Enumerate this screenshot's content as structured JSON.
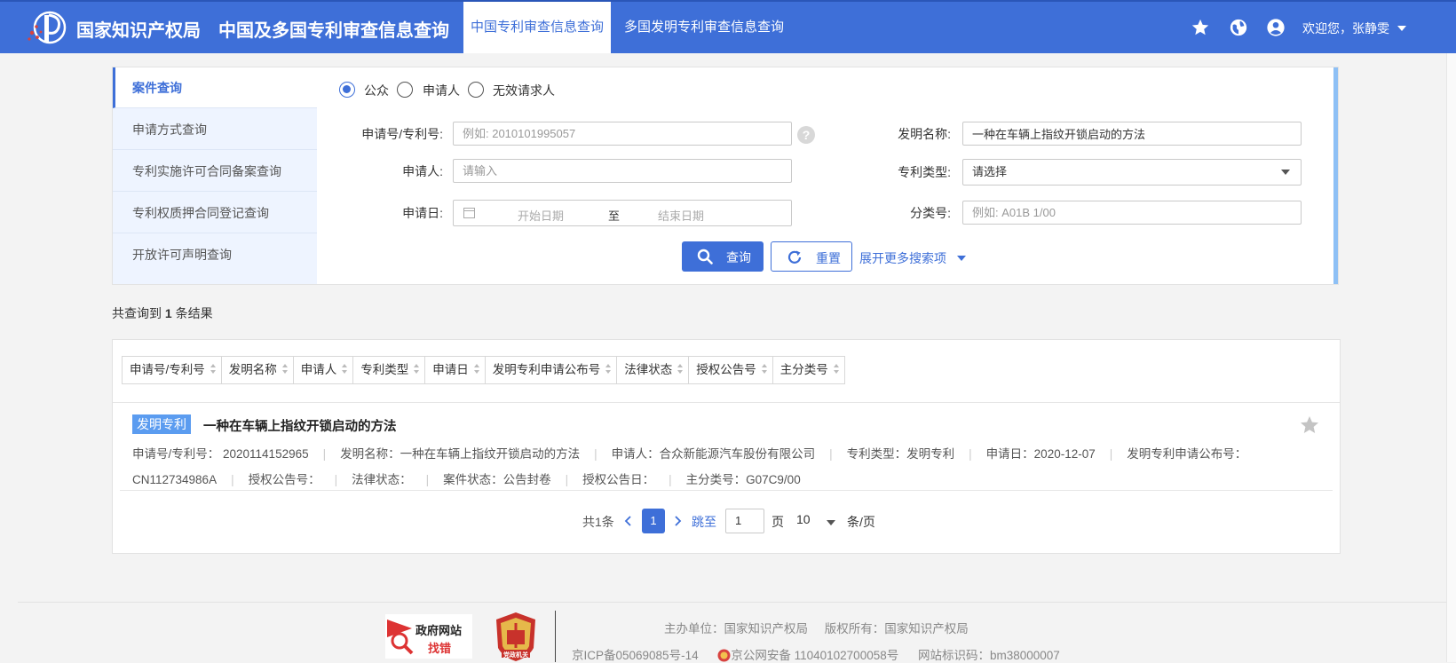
{
  "header": {
    "org_name": "国家知识产权局",
    "system_name": "中国及多国专利审查信息查询",
    "tabs": [
      {
        "label": "中国专利审查信息查询",
        "active": true
      },
      {
        "label": "多国发明专利审查信息查询",
        "active": false
      }
    ],
    "icons": [
      "star-icon",
      "globe-icon",
      "user-icon"
    ],
    "welcome": "欢迎您，张静雯",
    "colors": {
      "primary": "#3e6fd8",
      "accent_light": "#eef4ff"
    }
  },
  "side_menu": [
    {
      "label": "案件查询",
      "active": true
    },
    {
      "label": "申请方式查询",
      "active": false
    },
    {
      "label": "专利实施许可合同备案查询",
      "active": false
    },
    {
      "label": "专利权质押合同登记查询",
      "active": false
    },
    {
      "label": "开放许可声明查询",
      "active": false
    }
  ],
  "search": {
    "roles": [
      {
        "label": "公众",
        "checked": true
      },
      {
        "label": "申请人",
        "checked": false
      },
      {
        "label": "无效请求人",
        "checked": false
      }
    ],
    "app_no": {
      "label": "申请号/专利号:",
      "value": "",
      "placeholder": "例如: 2010101995057"
    },
    "invention_name": {
      "label": "发明名称:",
      "value": "一种在车辆上指纹开锁启动的方法",
      "placeholder": ""
    },
    "applicant": {
      "label": "申请人:",
      "value": "",
      "placeholder": "请输入"
    },
    "patent_type": {
      "label": "专利类型:",
      "value": "请选择"
    },
    "app_date": {
      "label": "申请日:",
      "start_placeholder": "开始日期",
      "separator": "至",
      "end_placeholder": "结束日期"
    },
    "classification": {
      "label": "分类号:",
      "value": "",
      "placeholder": "例如: A01B 1/00"
    },
    "search_label": "查询",
    "reset_label": "重置",
    "more_label": "展开更多搜索项",
    "help_glyph": "?"
  },
  "results": {
    "count_prefix": "共查询到",
    "count": "1",
    "count_suffix": "条结果",
    "sort_columns": [
      "申请号/专利号",
      "发明名称",
      "申请人",
      "专利类型",
      "申请日",
      "发明专利申请公布号",
      "法律状态",
      "授权公告号",
      "主分类号"
    ],
    "items": [
      {
        "type_badge": "发明专利",
        "title": "一种在车辆上指纹开锁启动的方法",
        "line1": [
          "申请号/专利号：  2020114152965",
          "发明名称：一种在车辆上指纹开锁启动的方法",
          "申请人：合众新能源汽车股份有限公司",
          "专利类型：发明专利",
          "申请日：2020-12-07",
          "发明专利申请公布号："
        ],
        "line2": [
          "CN112734986A",
          "授权公告号：",
          "法律状态：",
          "案件状态：公告封卷",
          "授权公告日：",
          "主分类号：G07C9/00"
        ]
      }
    ],
    "pagination": {
      "total_text": "共1条",
      "current_page": "1",
      "jump_label": "跳至",
      "jump_value": "1",
      "page_unit": "页",
      "page_size": "10",
      "size_unit": "条/页"
    }
  },
  "footer": {
    "gov_site_line1": "政府网站",
    "gov_site_line2": "找错",
    "party_badge": "党政机关",
    "host_line": "主办单位：国家知识产权局     版权所有：国家知识产权局",
    "icp": "京ICP备05069085号-14",
    "police": "京公网安备 11040102700058号",
    "site_id": "网站标识码：bm38000007"
  }
}
